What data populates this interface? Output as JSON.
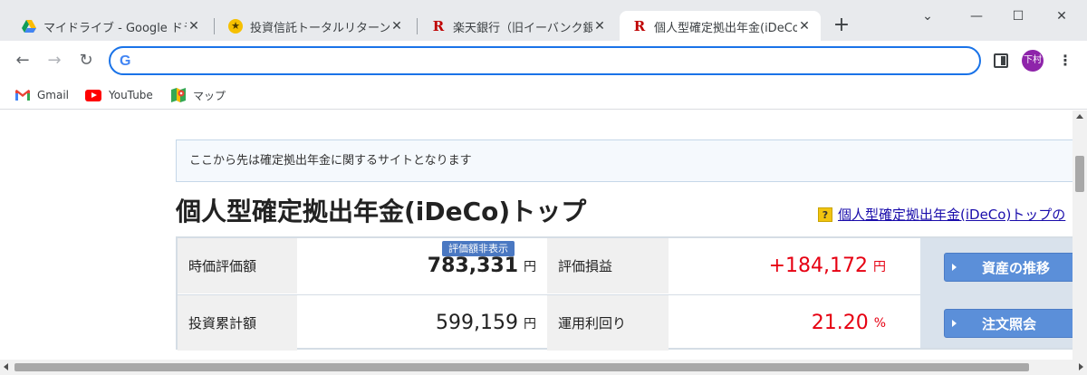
{
  "browser": {
    "tabs": [
      {
        "title": "マイドライブ - Google ドライブ",
        "icon": "google-drive-icon"
      },
      {
        "title": "投資信託トータルリターン／マ",
        "icon": "star-badge-icon"
      },
      {
        "title": "楽天銀行（旧イーバンク銀行",
        "icon": "rakuten-icon"
      },
      {
        "title": "個人型確定拠出年金(iDeCo",
        "icon": "rakuten-icon"
      }
    ],
    "new_tab": "+",
    "window_controls": {
      "minimize": "—",
      "maximize": "☐",
      "close": "✕",
      "dropdown": "⌄"
    },
    "nav": {
      "back": "←",
      "forward": "→",
      "reload": "↻"
    },
    "omnibox": {
      "value": "",
      "logo": "G"
    },
    "avatar_text": "下村",
    "menu": "⋮",
    "bookmarks": [
      {
        "label": "Gmail",
        "icon": "gmail-icon"
      },
      {
        "label": "YouTube",
        "icon": "youtube-icon"
      },
      {
        "label": "マップ",
        "icon": "maps-icon"
      }
    ]
  },
  "page": {
    "notice": "ここから先は確定拠出年金に関するサイトとなります",
    "title": "個人型確定拠出年金(iDeCo)トップ",
    "help_link": "個人型確定拠出年金(iDeCo)トップの",
    "help_icon_text": "?",
    "summary": {
      "market_value_label": "時価評価額",
      "market_value_badge": "評価額非表示",
      "market_value": "783,331",
      "market_value_unit": "円",
      "gain_label": "評価損益",
      "gain": "+184,172",
      "gain_unit": "円",
      "invested_label": "投資累計額",
      "invested": "599,159",
      "invested_unit": "円",
      "yield_label": "運用利回り",
      "yield": "21.20",
      "yield_unit": "%",
      "btn_asset_history": "資産の推移",
      "btn_order_inquiry": "注文照会"
    },
    "colors": {
      "accent_red": "#e60012",
      "button_blue": "#5b8fd9"
    }
  }
}
